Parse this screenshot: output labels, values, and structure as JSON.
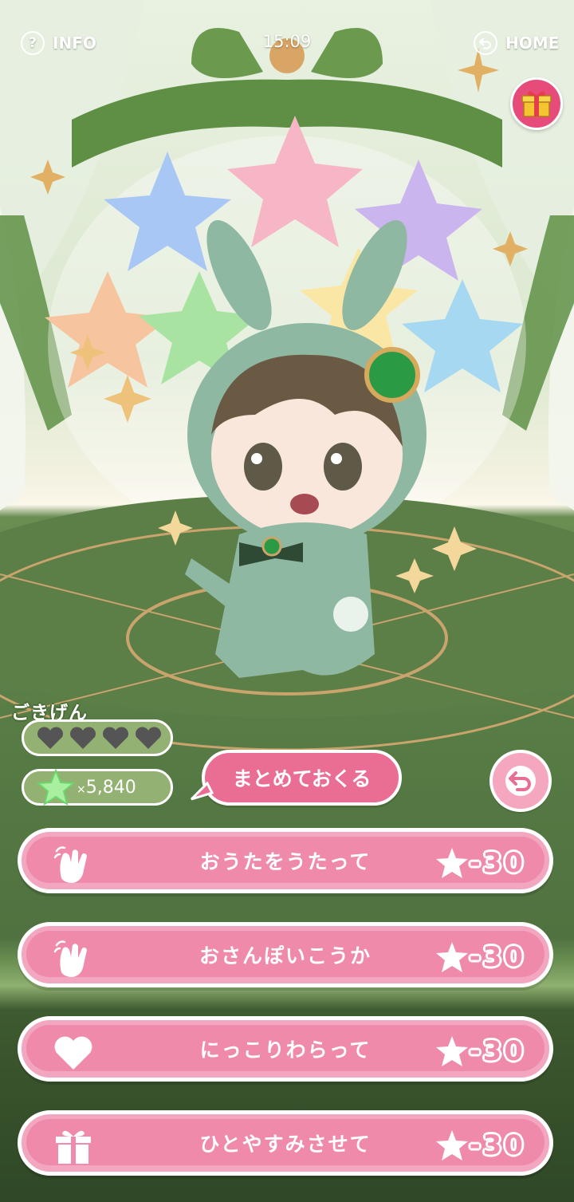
{
  "topbar": {
    "info_label": "INFO",
    "info_icon": "question-icon",
    "time": "15:09",
    "home_label": "HOME",
    "home_icon": "return-arrow-icon"
  },
  "mood": {
    "label": "ごきげん",
    "hearts_filled": 0,
    "hearts_total": 4
  },
  "stars": {
    "prefix": "×",
    "count": "5,840"
  },
  "send_button": {
    "label": "まとめておくる"
  },
  "actions": [
    {
      "label": "おうたをうたって",
      "icon": "clap-hands-icon",
      "cost": "-30"
    },
    {
      "label": "おさんぽいこうか",
      "icon": "clap-hands-icon",
      "cost": "-30"
    },
    {
      "label": "にっこりわらって",
      "icon": "heart-icon",
      "cost": "-30"
    },
    {
      "label": "ひとやすみさせて",
      "icon": "gift-box-icon",
      "cost": "-30"
    }
  ],
  "colors": {
    "accent_pink": "#f08aab",
    "button_pink": "#ea6d94",
    "mood_green": "#93b172"
  }
}
